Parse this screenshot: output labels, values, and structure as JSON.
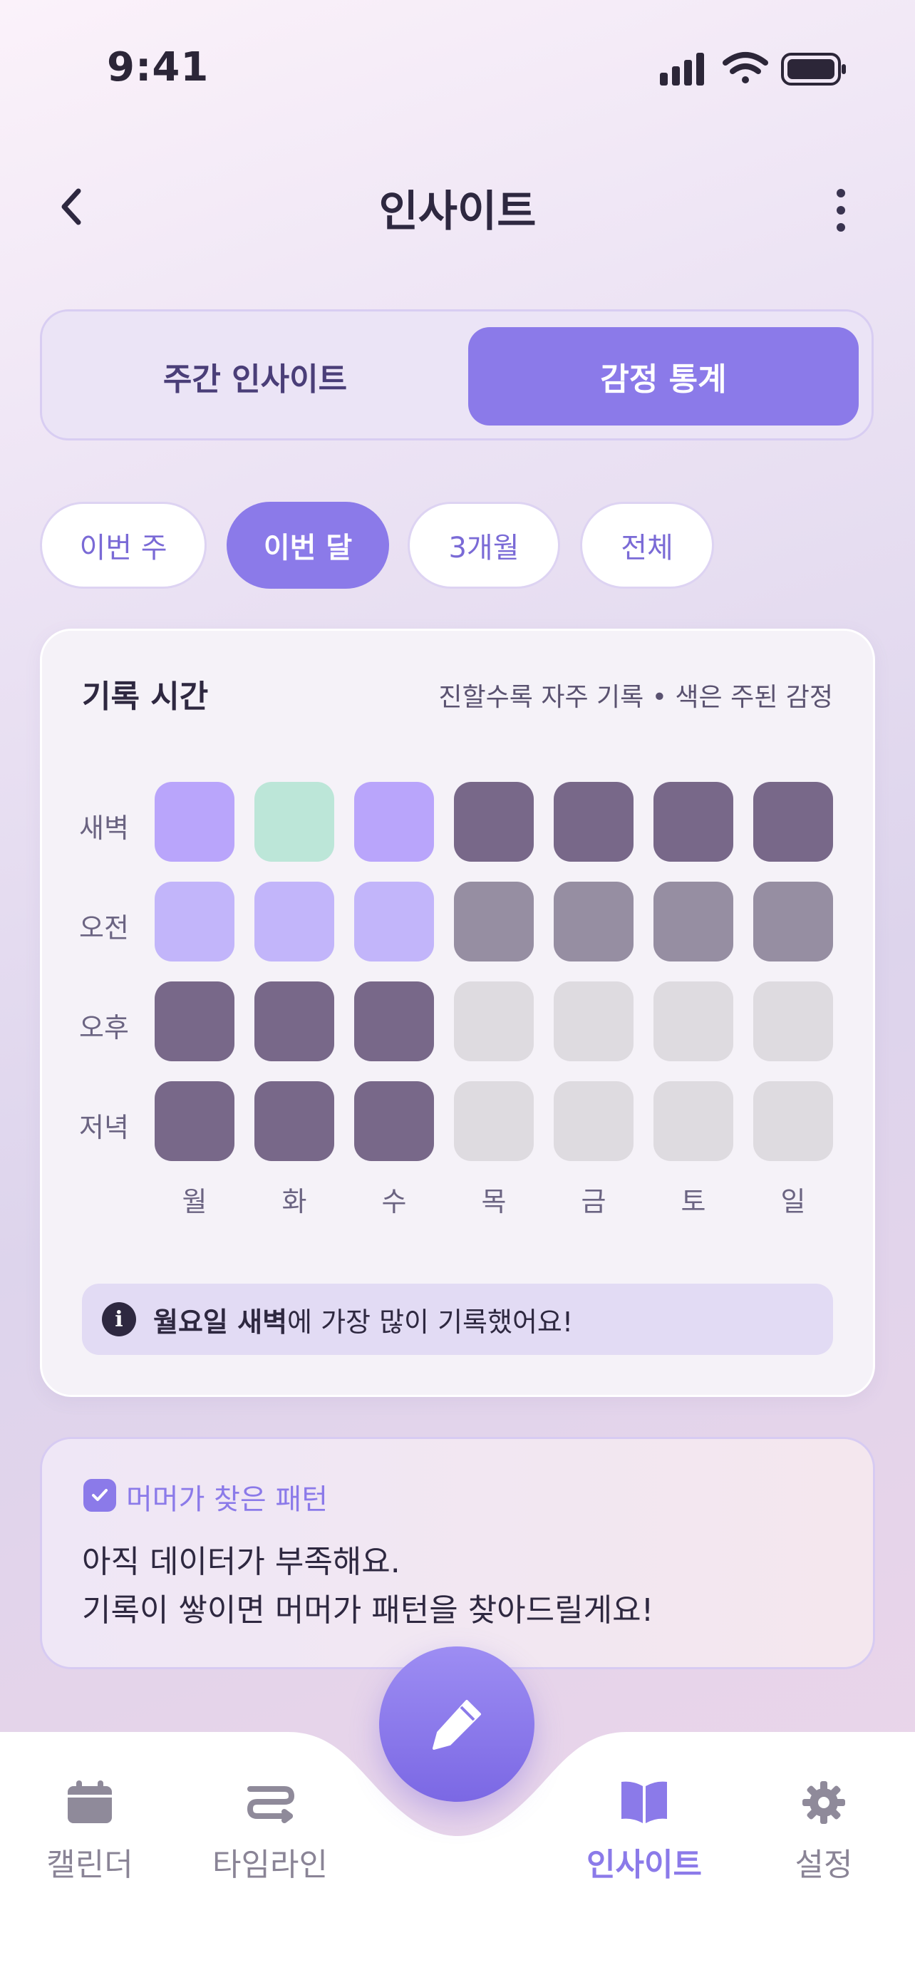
{
  "status": {
    "time": "9:41"
  },
  "header": {
    "title": "인사이트"
  },
  "segments": {
    "weekly": "주간 인사이트",
    "emotion": "감정 통계"
  },
  "periods": [
    "이번 주",
    "이번 달",
    "3개월",
    "전체"
  ],
  "record_card": {
    "title": "기록 시간",
    "hint": "진할수록 자주 기록 • 색은 주된 감정",
    "rows": [
      "새벽",
      "오전",
      "오후",
      "저녁"
    ],
    "days": [
      "월",
      "화",
      "수",
      "목",
      "금",
      "토",
      "일"
    ],
    "grid": [
      [
        "purple",
        "mint",
        "purple",
        "dark",
        "dark",
        "dark",
        "dark"
      ],
      [
        "lavender",
        "lavender",
        "lavender",
        "grey",
        "grey",
        "grey",
        "grey"
      ],
      [
        "dark",
        "dark",
        "dark",
        "empty",
        "empty",
        "empty",
        "empty"
      ],
      [
        "dark",
        "dark",
        "dark",
        "empty",
        "empty",
        "empty",
        "empty"
      ]
    ],
    "tip_icon": "info-icon",
    "tip_bold": "월요일 새벽",
    "tip_rest": "에 가장 많이 기록했어요!"
  },
  "pattern_card": {
    "label": "머머가 찾은 패턴",
    "line1": "아직 데이터가 부족해요.",
    "line2": "기록이 쌓이면 머머가 패턴을 찾아드릴게요!"
  },
  "nav": {
    "items": [
      {
        "label": "캘린더",
        "icon": "calendar-icon"
      },
      {
        "label": "타임라인",
        "icon": "timeline-icon"
      },
      {
        "label": "인사이트",
        "icon": "book-icon",
        "active": true
      },
      {
        "label": "설정",
        "icon": "gear-icon"
      }
    ],
    "fab_icon": "pencil-icon"
  },
  "colors": {
    "accent": "#8b7ae9",
    "purple": "#b9a5fb",
    "mint": "#bce6d8",
    "lavender": "#c2b5fa",
    "dark": "#786889",
    "grey": "#968ea2",
    "empty": "#dedbe0"
  }
}
